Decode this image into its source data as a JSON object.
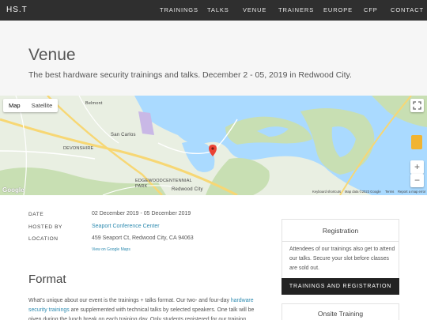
{
  "nav": {
    "brand": "HS.T",
    "items": [
      "TRAININGS",
      "TALKS",
      "VENUE",
      "TRAINERS",
      "EUROPE",
      "CFP",
      "CONTACT"
    ]
  },
  "hero": {
    "title": "Venue",
    "subtitle": "The best hardware security trainings and talks. December 2 - 05, 2019 in Redwood City."
  },
  "map": {
    "toggle": {
      "map": "Map",
      "satellite": "Satellite"
    },
    "labels": {
      "belmont": "Belmont",
      "san_carlos": "San Carlos",
      "devonshire": "DEVONSHIRE",
      "edgewood_park": "EDGEWOOD\nPARK",
      "centennial": "CENTENNIAL",
      "redwood_city": "Redwood City"
    },
    "footer": {
      "shortcuts": "Keyboard shortcuts",
      "data": "Map data ©2023 Google",
      "terms": "Terms",
      "report": "Report a map error"
    },
    "google": "Google",
    "zoom_in": "+",
    "zoom_out": "−",
    "colors": {
      "water": "#aadaff",
      "land": "#e9efe2",
      "park": "#c8dfb3",
      "road": "#f7d774",
      "pin": "#ea4335"
    }
  },
  "details": {
    "date_label": "DATE",
    "date_value": "02 December 2019 - 05 December 2019",
    "host_label": "HOSTED BY",
    "host_value": "Seaport Conference Center",
    "location_label": "LOCATION",
    "location_value": "459 Seaport Ct, Redwood City, CA 94063",
    "map_link": "View on Google Maps"
  },
  "format": {
    "title": "Format",
    "text_pre": "What's unique about our event is the trainings + talks format. Our two- and four-day ",
    "text_link": "hardware security trainings",
    "text_post": " are supplemented with technical talks by selected speakers. One talk will be given during the lunch break on each training day. Only students registered for our training"
  },
  "sidebar": {
    "registration": {
      "title": "Registration",
      "body": "Attendees of our trainings also get to attend our talks. Secure your slot before classes are sold out.",
      "button": "TRAININGS AND REGISTRATION"
    },
    "onsite": {
      "title": "Onsite Training"
    }
  }
}
